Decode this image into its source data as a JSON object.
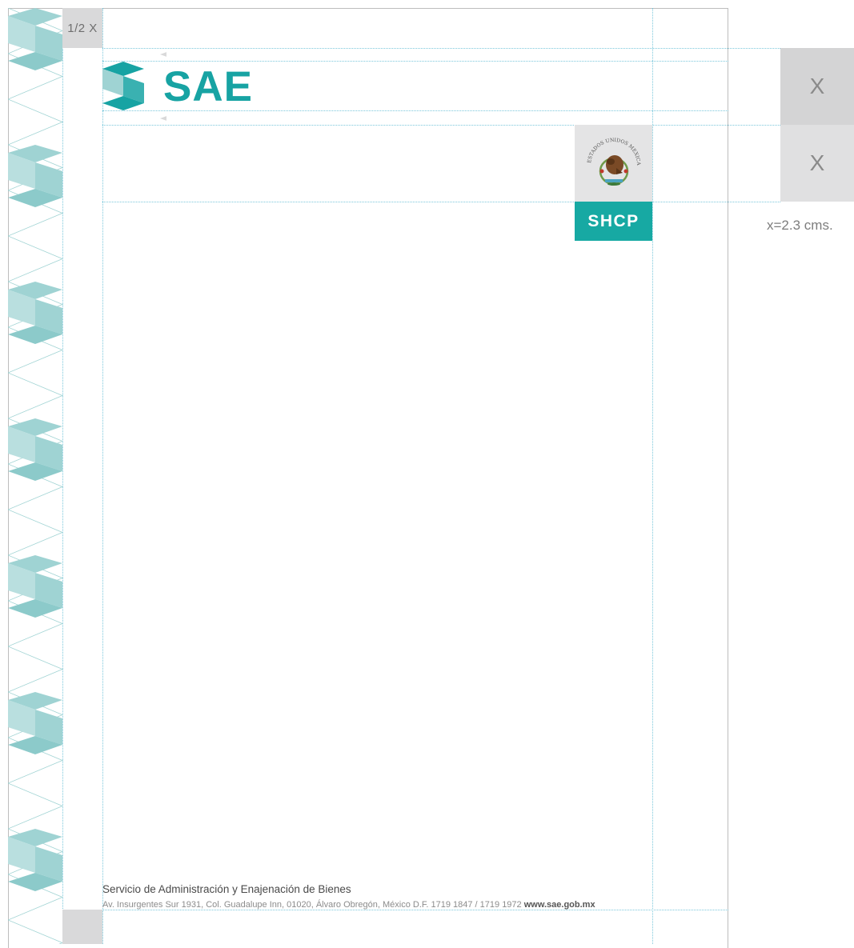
{
  "margin_label": "1/2 X",
  "unit_labels": [
    "X",
    "X"
  ],
  "scale_note": "x=2.3 cms.",
  "brand": {
    "name": "SAE",
    "teal": "#17a3a3",
    "teal_light": "#9fd3d3"
  },
  "seal": {
    "ring_text": "ESTADOS UNIDOS MEXICANOS"
  },
  "shcp_label": "SHCP",
  "footer": {
    "title": "Servicio de Administración y Enajenación de Bienes",
    "address": "Av. Insurgentes Sur 1931, Col. Guadalupe Inn, 01020, Álvaro Obregón, México D.F. 1719 1847 / 1719 1972",
    "website": "www.sae.gob.mx"
  },
  "colors": {
    "guide": "#7cc8dc",
    "block_gray": "#d9d9da"
  }
}
